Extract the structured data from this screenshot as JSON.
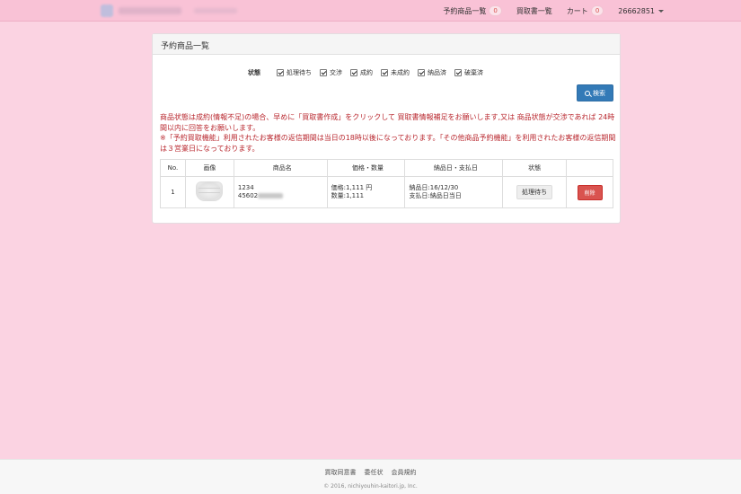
{
  "navbar": {
    "items": [
      {
        "label": "予約商品一覧",
        "badge": "0"
      },
      {
        "label": "買取書一覧"
      },
      {
        "label": "カート",
        "badge": "0"
      },
      {
        "label": "26662851"
      }
    ]
  },
  "panel": {
    "title": "予約商品一覧",
    "filter_label": "状態",
    "filters": [
      "処理待ち",
      "交渉",
      "成約",
      "未成約",
      "納品済",
      "破棄済"
    ],
    "search_label": "検索",
    "notice": [
      "商品状態は成約(情報不足)の場合、早めに「買取書作成」をクリックして 買取書情報補足をお願いします,又は 商品状態が交渉であれば 24時間以内に回答をお願いします。",
      "※「予約買取機能」利用されたお客様の返信期間は当日の18時以後になっております。「その他商品予約機能」を利用されたお客様の返信期間は３営業日になっております。"
    ],
    "table": {
      "headers": [
        "No.",
        "画像",
        "商品名",
        "価格・数量",
        "納品日・支払日",
        "状態",
        ""
      ],
      "rows": [
        {
          "no": "1",
          "name_line1": "1234",
          "name_line2": "45602",
          "price": "価格:1,111 円",
          "qty": "数量:1,111",
          "delivery": "納品日:16/12/30",
          "payment": "支払日:納品日当日",
          "status": "処理待ち",
          "delete_label": "削除"
        }
      ]
    }
  },
  "footer": {
    "links": [
      "買取同意書",
      "委任状",
      "会員規約"
    ],
    "copyright": "© 2016, nichiyouhin-kaitori.jp, Inc."
  },
  "colors": {
    "background": "#fbd3e2",
    "navbar": "#f9c2d6",
    "notice_text": "#b9282f",
    "primary": "#337ab7",
    "danger": "#d9534f"
  }
}
